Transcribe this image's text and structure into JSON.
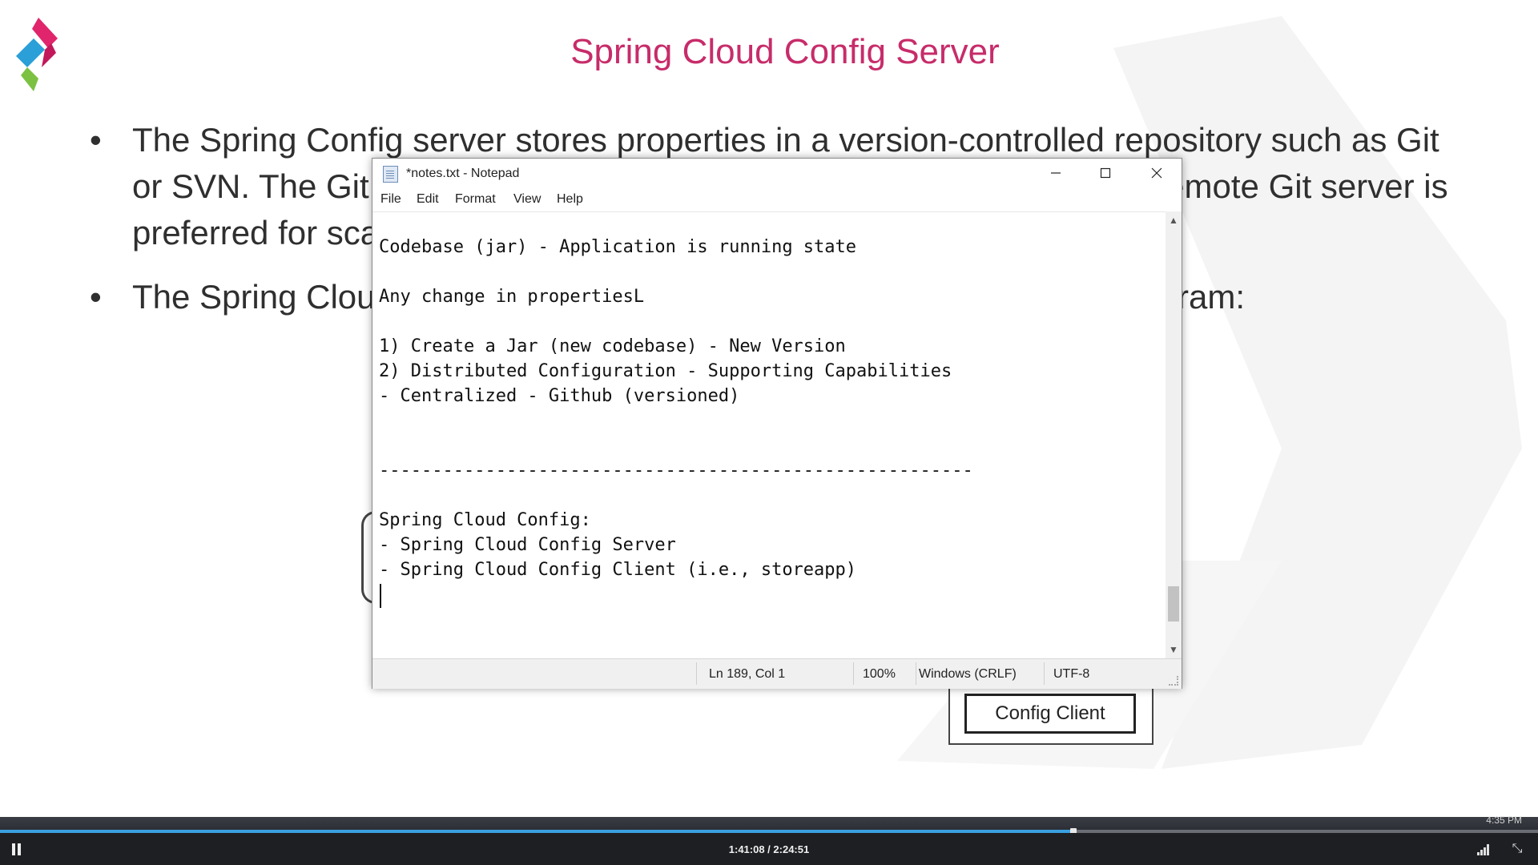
{
  "slide": {
    "title": "Spring Cloud Config Server",
    "bullets": [
      "The Spring Config server stores properties in a version-controlled repository such as Git or SVN. The Git repository can be local or remote. A highly available remote Git server is preferred for scalability purposes in production deployments.",
      "The Spring Cloud Config architecture is illustrated in the following diagram:"
    ],
    "diagram_label": "Config Client",
    "colors": {
      "title": "#c72c6a",
      "logo_pink": "#e0256c",
      "logo_blue": "#2a9fd8",
      "logo_green": "#7cc142"
    }
  },
  "notepad": {
    "title": "*notes.txt - Notepad",
    "menu": [
      "File",
      "Edit",
      "Format",
      "View",
      "Help"
    ],
    "lines": [
      "Codebase (jar) - Application is running state",
      "",
      "Any change in propertiesL",
      "",
      "1) Create a Jar (new codebase) - New Version",
      "2) Distributed Configuration - Supporting Capabilities",
      "- Centralized - Github (versioned)",
      "",
      "",
      "--------------------------------------------------------",
      "",
      "Spring Cloud Config:",
      "- Spring Cloud Config Server",
      "- Spring Cloud Config Client (i.e., storeapp)",
      "",
      ""
    ],
    "status": {
      "position": "Ln 189, Col 1",
      "zoom": "100%",
      "line_ending": "Windows (CRLF)",
      "encoding": "UTF-8"
    }
  },
  "player": {
    "time": "1:41:08 / 2:24:51",
    "progress_fraction": 0.698,
    "clock_fragment": "4:35 PM"
  }
}
